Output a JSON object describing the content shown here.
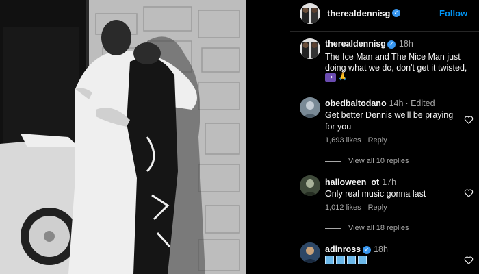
{
  "post": {
    "username": "therealdennisg",
    "follow_label": "Follow",
    "verified_mark": "✓"
  },
  "caption": {
    "username": "therealdennisg",
    "time": "18h",
    "text": "The Ice Man and The Nice Man just doing what we do, don't get it twisted,",
    "emoji_arrow": "SOON",
    "emoji_hands": "🙏"
  },
  "comments": [
    {
      "username": "obedbaltodano",
      "time": "14h",
      "edited": "· Edited",
      "text": "Get better Dennis we'll be praying for you",
      "likes": "1,693 likes",
      "reply": "Reply",
      "view_replies": "View all 10 replies"
    },
    {
      "username": "halloween_ot",
      "time": "17h",
      "text": "Only real music gonna last",
      "likes": "1,012 likes",
      "reply": "Reply",
      "view_replies": "View all 18 replies"
    },
    {
      "username": "adinross",
      "time": "18h",
      "text": "🧊🧊🧊🧊",
      "likes": "",
      "reply": ""
    }
  ],
  "colors": {
    "accent": "#0095f6",
    "verified": "#3897f0",
    "muted": "#a8a8a8",
    "background": "#000000"
  }
}
